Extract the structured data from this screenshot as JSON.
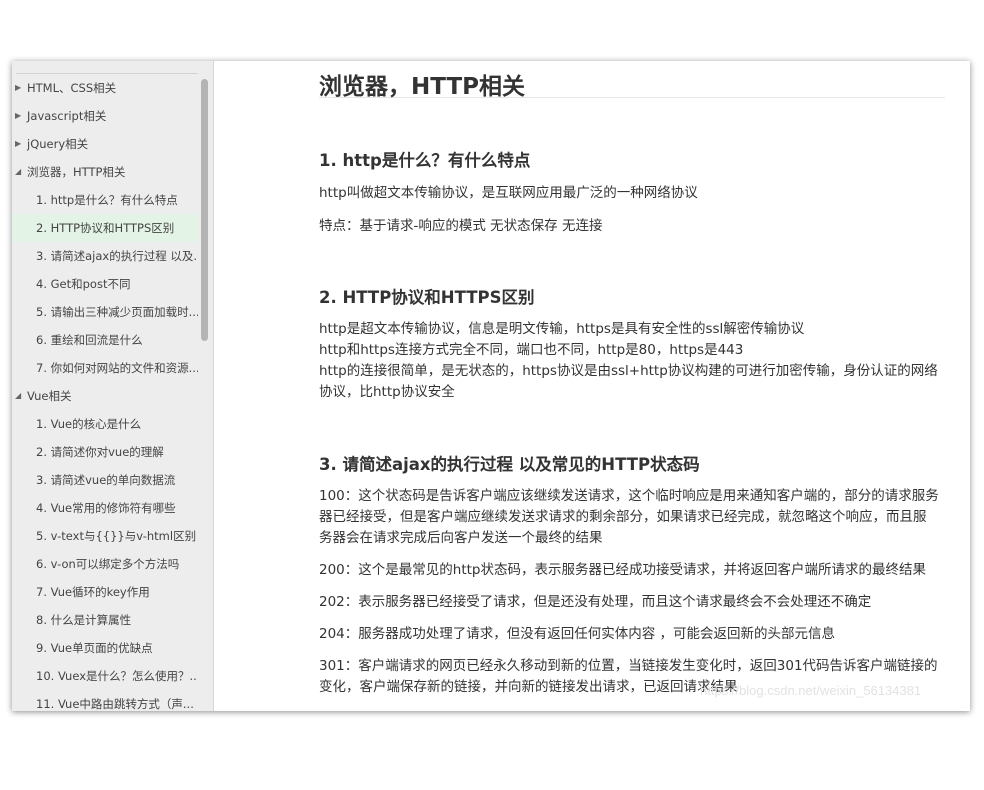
{
  "sidebar": {
    "items": [
      {
        "label": "HTML、CSS相关",
        "toggle": "▶"
      },
      {
        "label": "Javascript相关",
        "toggle": "▶"
      },
      {
        "label": "jQuery相关",
        "toggle": "▶"
      },
      {
        "label": "浏览器，HTTP相关",
        "toggle": "◢"
      },
      {
        "label": "1. http是什么？有什么特点"
      },
      {
        "label": "2. HTTP协议和HTTPS区别"
      },
      {
        "label": "3. 请简述ajax的执行过程 以及..."
      },
      {
        "label": "4. Get和post不同"
      },
      {
        "label": "5. 请输出三种减少页面加载时..."
      },
      {
        "label": "6. 重绘和回流是什么"
      },
      {
        "label": "7. 你如何对网站的文件和资源..."
      },
      {
        "label": "Vue相关",
        "toggle": "◢"
      },
      {
        "label": "1. Vue的核心是什么"
      },
      {
        "label": "2. 请简述你对vue的理解"
      },
      {
        "label": "3. 请简述vue的单向数据流"
      },
      {
        "label": "4. Vue常用的修饰符有哪些"
      },
      {
        "label": "5. v-text与{{}}与v-html区别"
      },
      {
        "label": "6. v-on可以绑定多个方法吗"
      },
      {
        "label": "7. Vue循环的key作用"
      },
      {
        "label": "8. 什么是计算属性"
      },
      {
        "label": "9. Vue单页面的优缺点"
      },
      {
        "label": "10. Vuex是什么？怎么使用？..."
      },
      {
        "label": "11. Vue中路由跳转方式（声..."
      }
    ]
  },
  "article": {
    "title": "浏览器，HTTP相关",
    "sections": [
      {
        "heading": "1. http是什么？有什么特点",
        "paragraphs": [
          "http叫做超文本传输协议，是互联网应用最广泛的一种网络协议",
          "特点：基于请求-响应的模式 无状态保存 无连接"
        ]
      },
      {
        "heading": "2. HTTP协议和HTTPS区别",
        "paragraphs": [
          "http是超文本传输协议，信息是明文传输，https是具有安全性的ssl解密传输协议",
          "http和https连接方式完全不同，端口也不同，http是80，https是443",
          "http的连接很简单，是无状态的，https协议是由ssl+http协议构建的可进行加密传输，身份认证的网络协议，比http协议安全"
        ]
      },
      {
        "heading": "3. 请简述ajax的执行过程 以及常见的HTTP状态码",
        "paragraphs": [
          "100：这个状态码是告诉客户端应该继续发送请求，这个临时响应是用来通知客户端的，部分的请求服务器已经接受，但是客户端应继续发送求请求的剩余部分，如果请求已经完成，就忽略这个响应，而且服务器会在请求完成后向客户发送一个最终的结果",
          "200：这个是最常见的http状态码，表示服务器已经成功接受请求，并将返回客户端所请求的最终结果",
          "202：表示服务器已经接受了请求，但是还没有处理，而且这个请求最终会不会处理还不确定",
          "204：服务器成功处理了请求，但没有返回任何实体内容 ，可能会返回新的头部元信息",
          "301：客户端请求的网页已经永久移动到新的位置，当链接发生变化时，返回301代码告诉客户端链接的变化，客户端保存新的链接，并向新的链接发出请求，已返回请求结果"
        ]
      }
    ]
  },
  "watermark": "https://blog.csdn.net/weixin_56134381"
}
